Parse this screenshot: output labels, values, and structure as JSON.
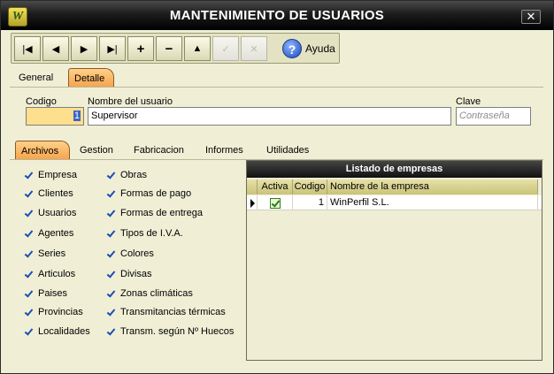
{
  "window": {
    "title": "MANTENIMIENTO DE USUARIOS",
    "app_icon_text": "W",
    "close_glyph": "✕"
  },
  "toolbar": {
    "buttons": [
      {
        "name": "first-record-button",
        "glyph": "|◀"
      },
      {
        "name": "prev-record-button",
        "glyph": "◀"
      },
      {
        "name": "next-record-button",
        "glyph": "▶"
      },
      {
        "name": "last-record-button",
        "glyph": "▶|"
      },
      {
        "name": "add-record-button",
        "glyph": "+"
      },
      {
        "name": "delete-record-button",
        "glyph": "−"
      },
      {
        "name": "edit-record-button",
        "glyph": "▲"
      },
      {
        "name": "confirm-button",
        "glyph": "✓"
      },
      {
        "name": "cancel-button",
        "glyph": "✕"
      }
    ],
    "help_label": "Ayuda",
    "help_glyph": "?"
  },
  "tabs": [
    {
      "label": "General",
      "active": false
    },
    {
      "label": "Detalle",
      "active": true
    }
  ],
  "form": {
    "codigo_label": "Codigo",
    "codigo_value": "1",
    "nombre_label": "Nombre del usuario",
    "nombre_value": "Supervisor",
    "clave_label": "Clave",
    "clave_placeholder": "Contraseña"
  },
  "subtabs": [
    {
      "label": "Archivos",
      "active": true
    },
    {
      "label": "Gestion",
      "active": false
    },
    {
      "label": "Fabricacion",
      "active": false
    },
    {
      "label": "Informes",
      "active": false
    },
    {
      "label": "Utilidades",
      "active": false
    }
  ],
  "permissions": {
    "column1": [
      "Empresa",
      "Clientes",
      "Usuarios",
      "Agentes",
      "Series",
      "Articulos",
      "Paises",
      "Provincias",
      "Localidades"
    ],
    "column2": [
      "Obras",
      "Formas de pago",
      "Formas de entrega",
      "Tipos de I.V.A.",
      "Colores",
      "Divisas",
      "Zonas climáticas",
      "Transmitancias térmicas",
      "Transm. según Nº Huecos"
    ]
  },
  "companies": {
    "title": "Listado de empresas",
    "columns": [
      "Activa",
      "Codigo",
      "Nombre de la empresa"
    ],
    "rows": [
      {
        "activa": true,
        "codigo": "1",
        "nombre": "WinPerfil S.L."
      }
    ]
  },
  "colors": {
    "window_bg": "#f0efd6",
    "titlebar": "#000000",
    "tab_active": "#f4a24a",
    "code_field": "#fedf8e"
  }
}
